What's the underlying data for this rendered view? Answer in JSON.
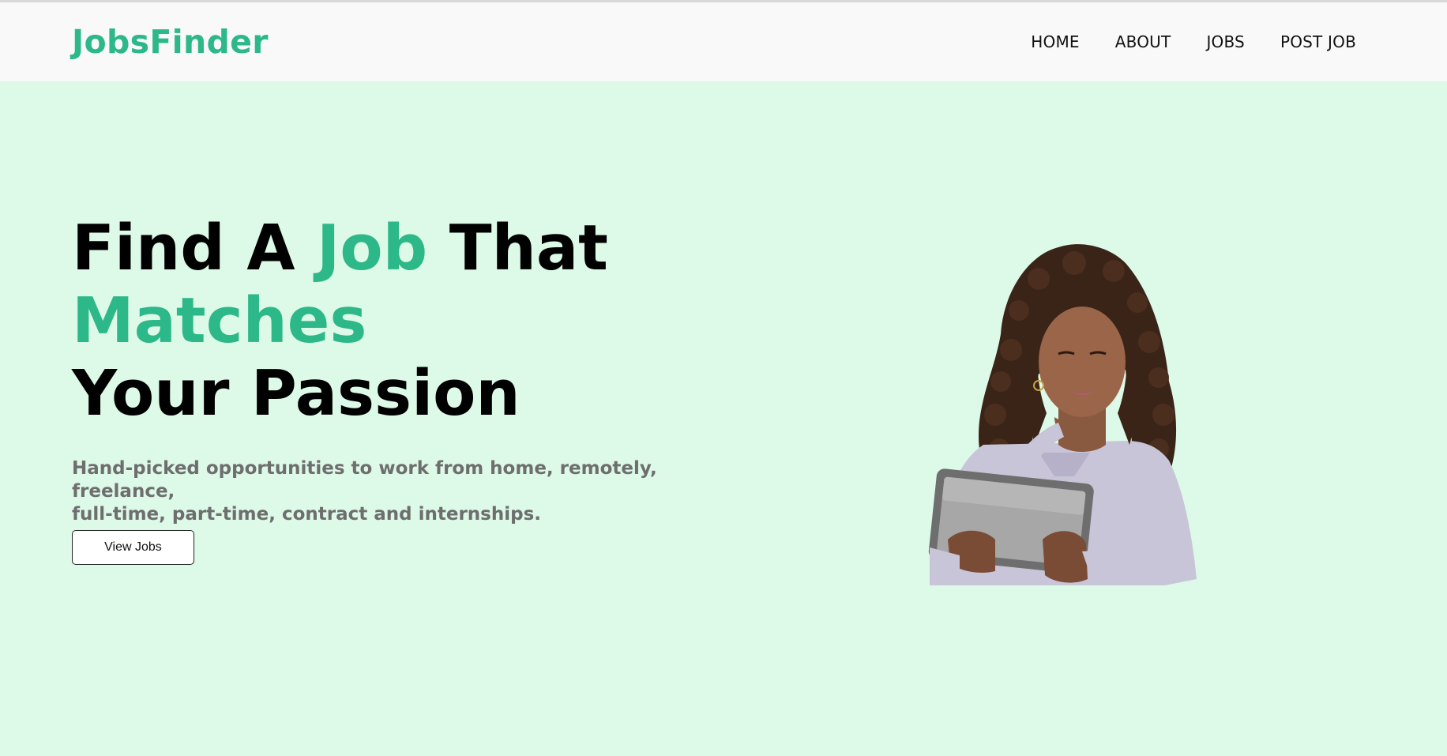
{
  "nav": {
    "logo": "JobsFinder",
    "links": [
      {
        "label": "HOME"
      },
      {
        "label": "ABOUT"
      },
      {
        "label": "JOBS"
      },
      {
        "label": "POST JOB"
      }
    ]
  },
  "hero": {
    "headline": {
      "line1_part1": "Find A ",
      "line1_accent": "Job",
      "line1_part2": " That",
      "line2_accent": "Matches",
      "line3": "Your Passion"
    },
    "subtext_line1": "Hand-picked opportunities to work from home, remotely, freelance,",
    "subtext_line2": "full-time, part-time, contract and internships.",
    "cta_label": "View Jobs"
  },
  "colors": {
    "brand": "#2db889",
    "hero_background": "#ddf9e8",
    "navbar_background": "#f9f9f9",
    "subtext": "#6e6e6e"
  },
  "image": {
    "subject": "woman-reading-tablet-photo"
  }
}
